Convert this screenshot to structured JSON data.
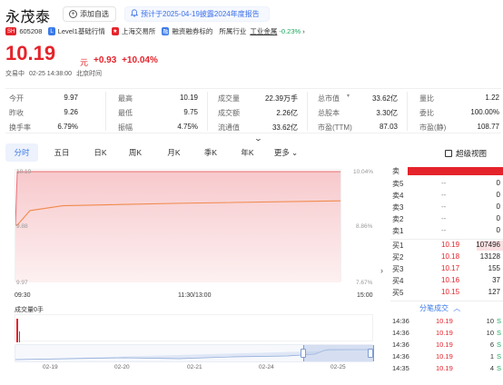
{
  "header": {
    "name": "永茂泰",
    "add_watchlist": "添加自选",
    "notice": "预计于2025-04-19披露2024年度报告",
    "market_tag": "SH",
    "code": "605208",
    "level": "Level1基础行情",
    "exchange": "上海交易所",
    "margin": "融资融券标的",
    "industry": "所属行业",
    "industry_name": "工业金属",
    "industry_change": "-0.23%"
  },
  "quote": {
    "price": "10.19",
    "unit": "元",
    "change": "+0.93",
    "change_pct": "+10.04%",
    "status": "交易中",
    "datetime": "02-25 14:38:00",
    "timezone": "北京时间"
  },
  "stats": [
    [
      {
        "label": "今开",
        "value": "9.97",
        "color": "red"
      },
      {
        "label": "最高",
        "value": "10.19",
        "color": "red"
      },
      {
        "label": "成交量",
        "value": "22.39万手"
      },
      {
        "label": "总市值",
        "value": "33.62亿"
      },
      {
        "label": "量比",
        "value": "1.22",
        "color": "red"
      }
    ],
    [
      {
        "label": "昨收",
        "value": "9.26"
      },
      {
        "label": "最低",
        "value": "9.75",
        "color": "red"
      },
      {
        "label": "成交额",
        "value": "2.26亿"
      },
      {
        "label": "总股本",
        "value": "3.30亿"
      },
      {
        "label": "委比",
        "value": "100.00%"
      }
    ],
    [
      {
        "label": "换手率",
        "value": "6.79%"
      },
      {
        "label": "振幅",
        "value": "4.75%"
      },
      {
        "label": "流通值",
        "value": "33.62亿"
      },
      {
        "label": "市盈(TTM)",
        "value": "87.03"
      },
      {
        "label": "市盈(静)",
        "value": "108.77"
      }
    ]
  ],
  "tabs": [
    "分时",
    "五日",
    "日K",
    "周K",
    "月K",
    "季K",
    "年K",
    "更多"
  ],
  "active_tab": 0,
  "super_view": "超级视图",
  "chart": {
    "y_left_top": "10.19",
    "y_left_mid": "9.88",
    "y_left_bottom": "9.97",
    "y_right_top": "10.04%",
    "y_right_mid": "8.86%",
    "y_right_bottom": "7.67%",
    "times": [
      "09:30",
      "11:30/13:00",
      "15:00"
    ],
    "volume_label": "成交量0手",
    "dates": [
      "02-19",
      "02-20",
      "02-21",
      "02-24",
      "02-25"
    ]
  },
  "chart_data": {
    "type": "line",
    "x": [
      "09:30",
      "09:31",
      "09:40",
      "10:00",
      "11:30/13:00",
      "14:38"
    ],
    "series": [
      {
        "values": [
          9.97,
          10.19,
          10.19,
          10.19,
          10.19,
          10.19
        ]
      },
      {
        "values": [
          9.97,
          9.97,
          10.03,
          10.05,
          10.06,
          10.07
        ]
      }
    ],
    "ylim": [
      9.75,
      10.19
    ]
  },
  "orderbook": {
    "sell_header": "卖",
    "sells": [
      {
        "label": "卖5",
        "price": "--",
        "vol": "0"
      },
      {
        "label": "卖4",
        "price": "--",
        "vol": "0"
      },
      {
        "label": "卖3",
        "price": "--",
        "vol": "0"
      },
      {
        "label": "卖2",
        "price": "--",
        "vol": "0"
      },
      {
        "label": "卖1",
        "price": "--",
        "vol": "0"
      }
    ],
    "buys": [
      {
        "label": "买1",
        "price": "10.19",
        "vol": "107496"
      },
      {
        "label": "买2",
        "price": "10.18",
        "vol": "13128"
      },
      {
        "label": "买3",
        "price": "10.17",
        "vol": "155"
      },
      {
        "label": "买4",
        "price": "10.16",
        "vol": "37"
      },
      {
        "label": "买5",
        "price": "10.15",
        "vol": "127"
      }
    ]
  },
  "trades": {
    "title": "分笔成交",
    "rows": [
      {
        "time": "14:36",
        "price": "10.19",
        "vol": "10",
        "side": "S"
      },
      {
        "time": "14:36",
        "price": "10.19",
        "vol": "10",
        "side": "S"
      },
      {
        "time": "14:36",
        "price": "10.19",
        "vol": "6",
        "side": "S"
      },
      {
        "time": "14:36",
        "price": "10.19",
        "vol": "1",
        "side": "S"
      },
      {
        "time": "14:35",
        "price": "10.19",
        "vol": "4",
        "side": "S"
      }
    ]
  },
  "colors": {
    "up": "#e5232b",
    "down": "#1aa75b",
    "accent": "#3b7ae8"
  }
}
